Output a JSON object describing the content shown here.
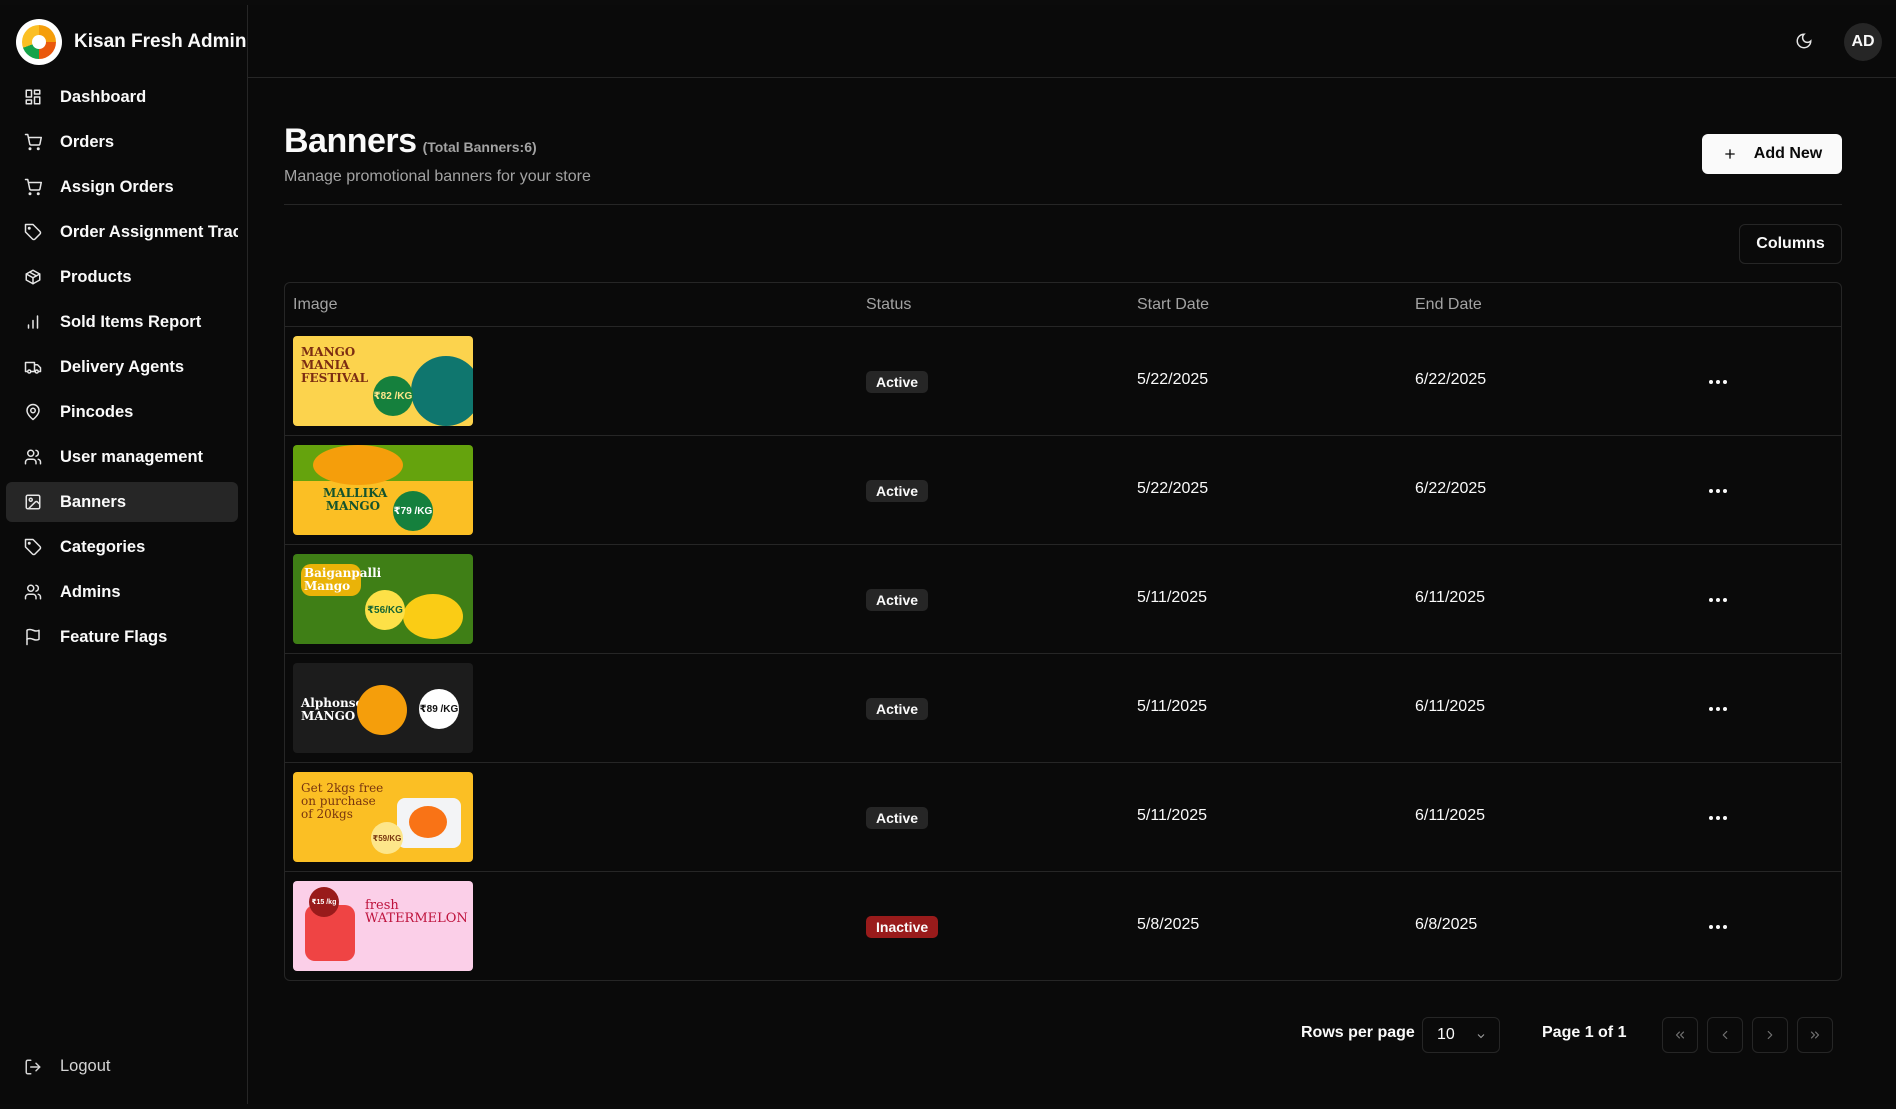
{
  "app": {
    "name": "Kisan Fresh Admin",
    "avatar_initials": "AD"
  },
  "sidebar": {
    "items": [
      {
        "label": "Dashboard",
        "icon": "dashboard-icon"
      },
      {
        "label": "Orders",
        "icon": "cart-icon"
      },
      {
        "label": "Assign Orders",
        "icon": "cart-icon"
      },
      {
        "label": "Order Assignment Tracking",
        "icon": "tag-icon"
      },
      {
        "label": "Products",
        "icon": "package-icon"
      },
      {
        "label": "Sold Items Report",
        "icon": "bar-chart-icon"
      },
      {
        "label": "Delivery Agents",
        "icon": "truck-icon"
      },
      {
        "label": "Pincodes",
        "icon": "map-pin-icon"
      },
      {
        "label": "User management",
        "icon": "users-icon"
      },
      {
        "label": "Banners",
        "icon": "image-icon",
        "active": true
      },
      {
        "label": "Categories",
        "icon": "tag-icon"
      },
      {
        "label": "Admins",
        "icon": "users-icon"
      },
      {
        "label": "Feature Flags",
        "icon": "flag-icon"
      }
    ],
    "logout_label": "Logout"
  },
  "header": {
    "title": "Banners",
    "count_label": "(Total Banners:6)",
    "subtitle": "Manage promotional banners for your store",
    "add_button": "Add New",
    "columns_button": "Columns"
  },
  "table": {
    "columns": [
      "Image",
      "Status",
      "Start Date",
      "End Date"
    ],
    "rows": [
      {
        "banner_text": "MANGO MANIA FESTIVAL",
        "banner_price": "₹82 /KG",
        "status": "Active",
        "start": "5/22/2025",
        "end": "6/22/2025"
      },
      {
        "banner_text": "MALLIKA MANGO",
        "banner_price": "₹79 /KG",
        "status": "Active",
        "start": "5/22/2025",
        "end": "6/22/2025"
      },
      {
        "banner_text": "Baiganpalli Mango",
        "banner_price": "₹56/KG",
        "status": "Active",
        "start": "5/11/2025",
        "end": "6/11/2025"
      },
      {
        "banner_text": "Alphonso MANGO",
        "banner_price": "₹89 /KG",
        "status": "Active",
        "start": "5/11/2025",
        "end": "6/11/2025"
      },
      {
        "banner_text": "Get 2kgs free on purchase of 20kgs",
        "banner_price": "₹59/KG",
        "status": "Active",
        "start": "5/11/2025",
        "end": "6/11/2025"
      },
      {
        "banner_text": "fresh WATERMELON",
        "banner_price": "₹15 /kg",
        "status": "Inactive",
        "start": "5/8/2025",
        "end": "6/8/2025"
      }
    ]
  },
  "pagination": {
    "rows_per_page_label": "Rows per page",
    "rows_per_page_value": "10",
    "page_info": "Page 1 of 1"
  },
  "colors": {
    "active_nav_bg": "#262626",
    "inactive_badge": "#991b1b",
    "background": "#0a0a0a"
  }
}
